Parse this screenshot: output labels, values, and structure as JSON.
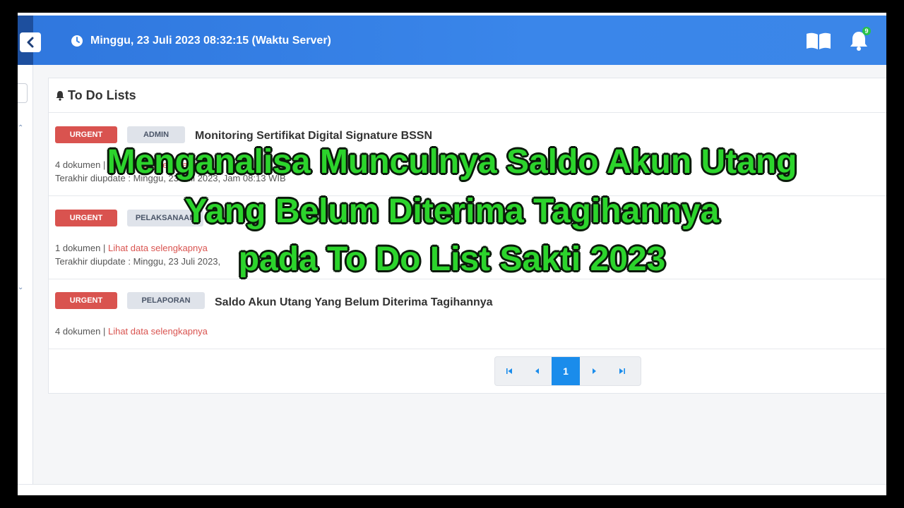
{
  "header": {
    "datetime": "Minggu, 23 Juli 2023 08:32:15 (Waktu Server)",
    "notification_count": "9",
    "colors": {
      "header": "#3a86ea",
      "accent": "#1a8ceb",
      "urgent": "#d9534f"
    }
  },
  "card": {
    "title": "To Do Lists"
  },
  "items": [
    {
      "priority": "URGENT",
      "category": "ADMIN",
      "title": "Monitoring Sertifikat Digital Signature BSSN",
      "count": "4 dokumen",
      "separator": "|",
      "link": "Lihat data selengkapnya",
      "updated": "Terakhir diupdate : Minggu, 23 Juli 2023, Jam 08:13 WIB"
    },
    {
      "priority": "URGENT",
      "category": "PELAKSANAAN",
      "title": "",
      "count": "1 dokumen",
      "separator": "|",
      "link": "Lihat data selengkapnya",
      "updated": "Terakhir diupdate : Minggu, 23 Juli 2023,"
    },
    {
      "priority": "URGENT",
      "category": "PELAPORAN",
      "title": "Saldo Akun Utang Yang Belum Diterima Tagihannya",
      "count": "4 dokumen",
      "separator": "|",
      "link": "Lihat data selengkapnya",
      "updated": ""
    }
  ],
  "pagination": {
    "current_page": "1"
  },
  "overlay": {
    "line1": "Menganalisa Munculnya  Saldo Akun Utang",
    "line2": "Yang Belum Diterima Tagihannya",
    "line3": "pada To Do List Sakti 2023"
  }
}
